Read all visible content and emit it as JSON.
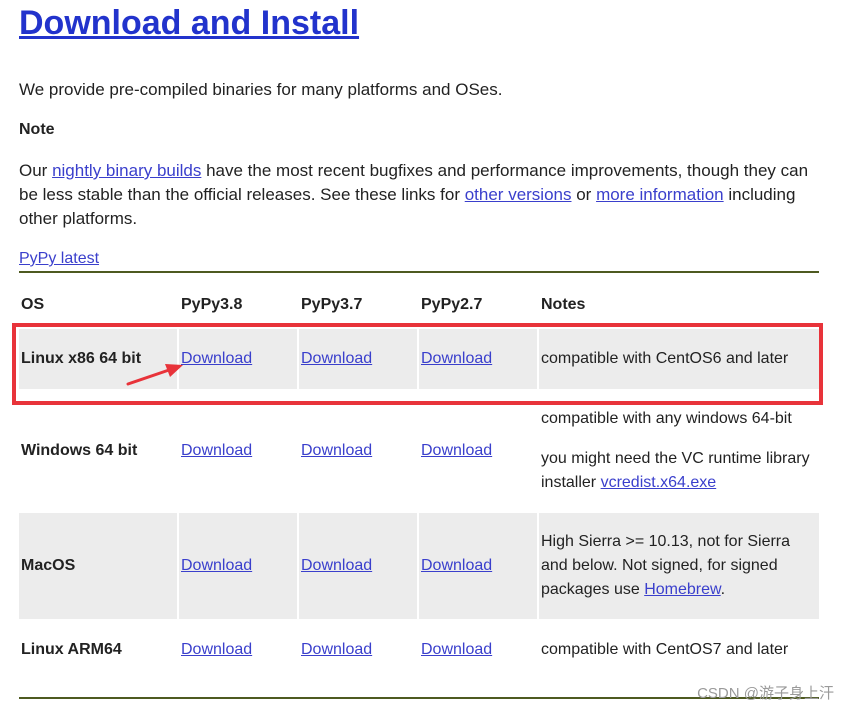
{
  "page": {
    "title": "Download and Install",
    "intro": "We provide pre-compiled binaries for many platforms and OSes.",
    "note_heading": "Note",
    "note": {
      "text_1": "Our ",
      "link_nightly": "nightly binary builds",
      "text_2": " have the most recent bugfixes and performance improvements, though they can be less stable than the official releases. See these links for ",
      "link_other_versions": "other versions",
      "text_3": " or ",
      "link_more_info": "more information",
      "text_4": " including other platforms."
    },
    "latest_link": "PyPy latest"
  },
  "table": {
    "headers": [
      "OS",
      "PyPy3.8",
      "PyPy3.7",
      "PyPy2.7",
      "Notes"
    ],
    "rows": [
      {
        "os": "Linux x86 64 bit",
        "d1": "Download",
        "d2": "Download",
        "d3": "Download",
        "note_1": "compatible with CentOS6 and later"
      },
      {
        "os": "Windows 64 bit",
        "d1": "Download",
        "d2": "Download",
        "d3": "Download",
        "note_1": "compatible with any windows 64-bit",
        "note_2": "you might need the VC runtime library installer ",
        "note_link": "vcredist.x64.exe"
      },
      {
        "os": "MacOS",
        "d1": "Download",
        "d2": "Download",
        "d3": "Download",
        "note_1": "High Sierra >= 10.13, not for Sierra and below. Not signed, for signed packages use ",
        "note_link": "Homebrew",
        "note_2": "."
      },
      {
        "os": "Linux ARM64",
        "d1": "Download",
        "d2": "Download",
        "d3": "Download",
        "note_1": "compatible with CentOS7 and later"
      }
    ]
  },
  "annotation": {
    "highlight_color": "#e8333a",
    "arrow_color": "#e8333a"
  },
  "watermark": "CSDN @游子身上汗",
  "colors": {
    "link": "#3a3fcc",
    "title": "#2233cc",
    "rule": "#4e5a20",
    "row_shade": "#ececec"
  }
}
